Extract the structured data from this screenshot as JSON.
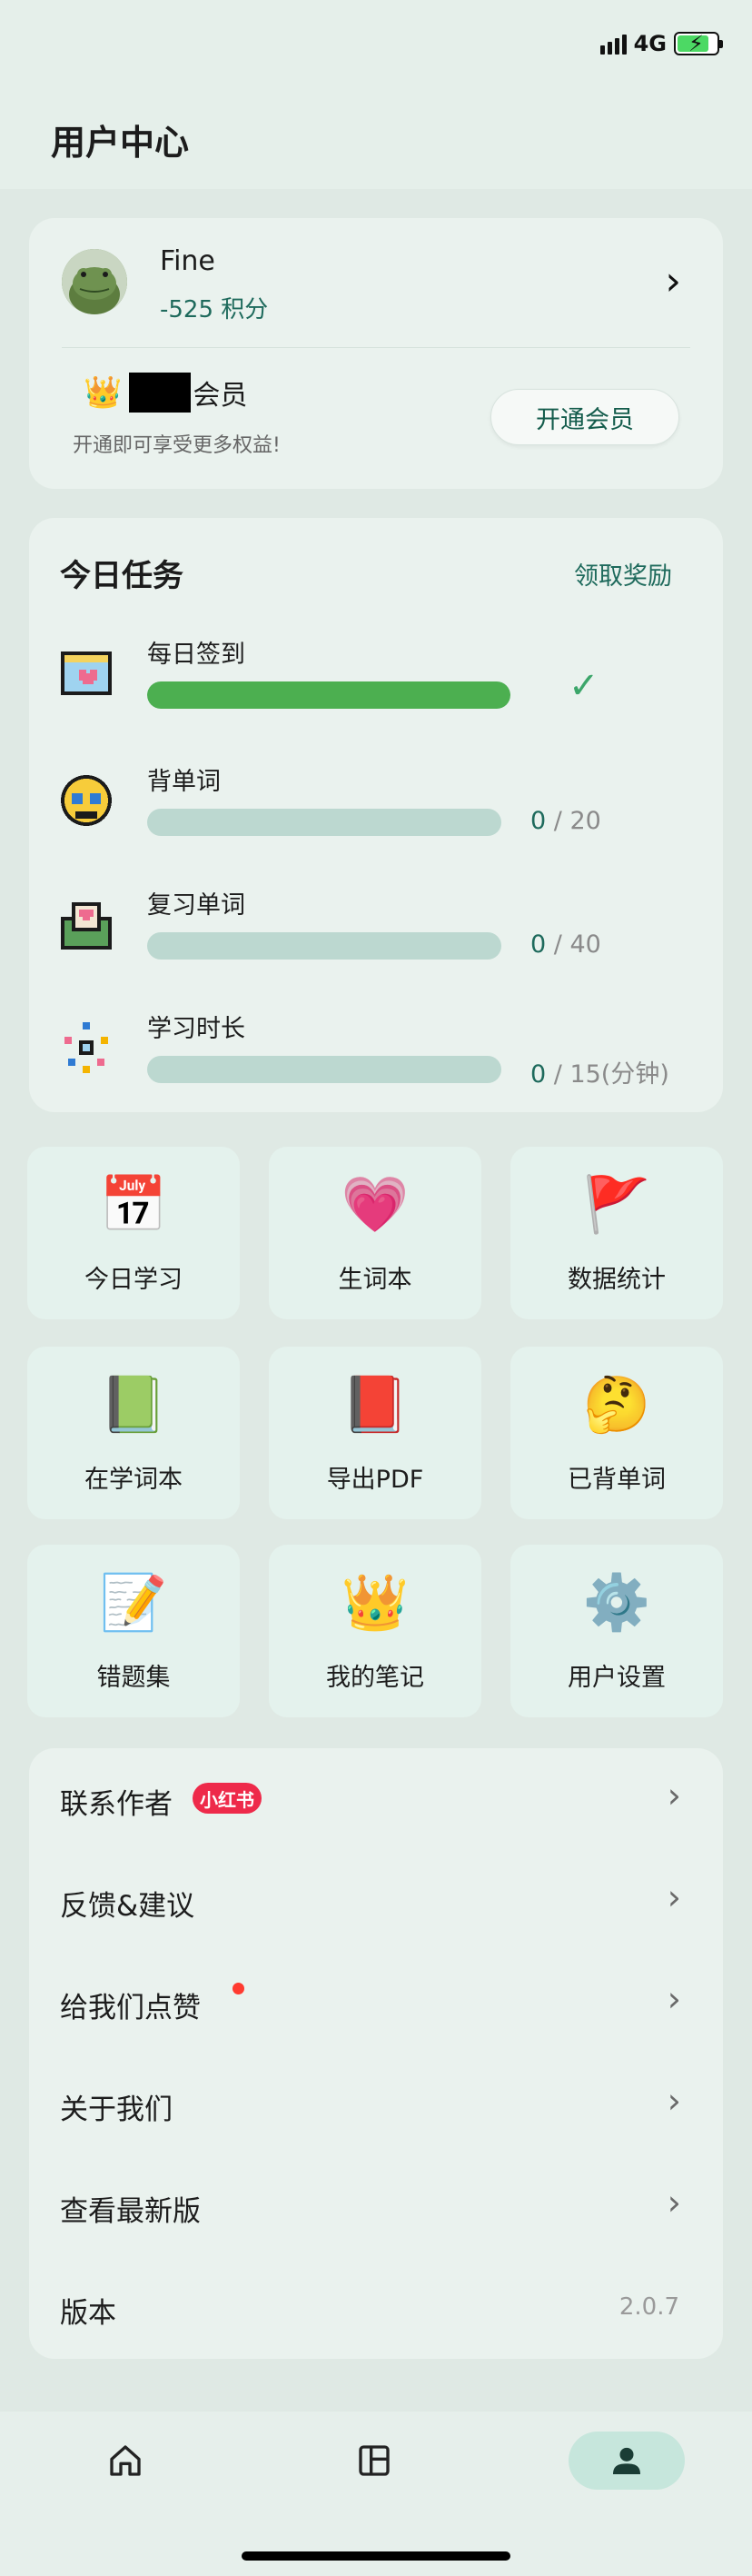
{
  "status_bar": {
    "network": "4G"
  },
  "header": {
    "title": "用户中心"
  },
  "profile": {
    "name": "Fine",
    "points": "-525 积分",
    "member_label": "会员",
    "member_desc": "开通即可享受更多权益!",
    "open_button": "开通会员"
  },
  "tasks": {
    "title": "今日任务",
    "claim_label": "领取奖励",
    "items": [
      {
        "name": "每日签到",
        "progress": 1.0,
        "completed": true
      },
      {
        "name": "背单词",
        "current": "0",
        "total": "20",
        "progress": 0
      },
      {
        "name": "复习单词",
        "current": "0",
        "total": "40",
        "progress": 0
      },
      {
        "name": "学习时长",
        "current": "0",
        "total": "15(分钟)",
        "progress": 0
      }
    ]
  },
  "grid": {
    "items": [
      {
        "label": "今日学习",
        "icon": "calendar-icon"
      },
      {
        "label": "生词本",
        "icon": "heart-icon"
      },
      {
        "label": "数据统计",
        "icon": "flag-icon"
      },
      {
        "label": "在学词本",
        "icon": "green-book-icon"
      },
      {
        "label": "导出PDF",
        "icon": "pink-book-icon"
      },
      {
        "label": "已背单词",
        "icon": "thinking-face-icon"
      },
      {
        "label": "错题集",
        "icon": "paper-pencil-icon"
      },
      {
        "label": "我的笔记",
        "icon": "crown-icon"
      },
      {
        "label": "用户设置",
        "icon": "gear-icon"
      }
    ]
  },
  "menu": {
    "items": [
      {
        "label": "联系作者",
        "badge": "小红书"
      },
      {
        "label": "反馈&建议"
      },
      {
        "label": "给我们点赞"
      },
      {
        "label": "关于我们"
      },
      {
        "label": "查看最新版"
      },
      {
        "label": "版本",
        "value": "2.0.7"
      }
    ]
  },
  "bottom_nav": {
    "items": [
      {
        "icon": "home-icon"
      },
      {
        "icon": "layout-icon"
      },
      {
        "icon": "user-icon",
        "active": true
      }
    ]
  },
  "colors": {
    "accent": "#1e6a5c",
    "progress_done": "#4caf50",
    "progress_track": "#bcd8d0"
  }
}
